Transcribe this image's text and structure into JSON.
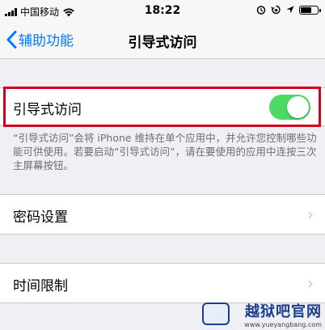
{
  "status_bar": {
    "carrier": "中国移动",
    "time": "18:22",
    "battery_level": 0.75
  },
  "nav": {
    "back_label": "辅助功能",
    "title": "引导式访问"
  },
  "guided_access": {
    "label": "引导式访问",
    "enabled": true,
    "toggle_color": "#4cd964"
  },
  "footer_text": "“引导式访问”会将 iPhone 维持在单个应用中，并允许您控制哪些功能可供使用。若要启动“引导式访问”，请在要使用的应用中连按三次主屏幕按钮。",
  "passcode_settings": {
    "label": "密码设置"
  },
  "time_limits": {
    "label": "时间限制"
  },
  "watermark": {
    "brand": "越狱吧官网",
    "url": "www.yueyangbang.com"
  },
  "colors": {
    "accent": "#007aff",
    "highlight_border": "#d0021b"
  }
}
